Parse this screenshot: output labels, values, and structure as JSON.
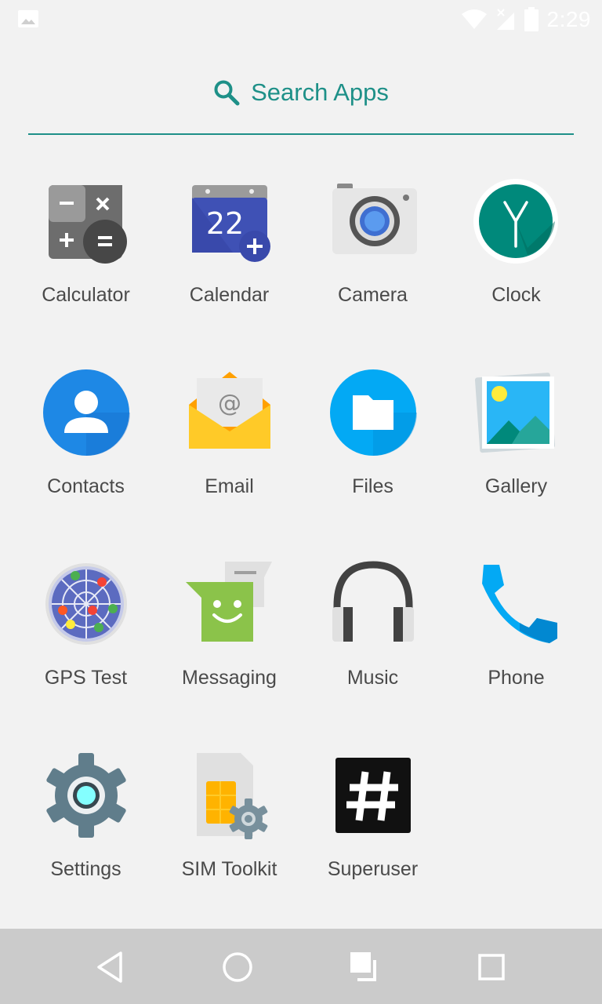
{
  "status_bar": {
    "time": "2:29"
  },
  "search": {
    "label": "Search Apps"
  },
  "apps": [
    {
      "label": "Calculator"
    },
    {
      "label": "Calendar"
    },
    {
      "label": "Camera"
    },
    {
      "label": "Clock"
    },
    {
      "label": "Contacts"
    },
    {
      "label": "Email"
    },
    {
      "label": "Files"
    },
    {
      "label": "Gallery"
    },
    {
      "label": "GPS Test"
    },
    {
      "label": "Messaging"
    },
    {
      "label": "Music"
    },
    {
      "label": "Phone"
    },
    {
      "label": "Settings"
    },
    {
      "label": "SIM Toolkit"
    },
    {
      "label": "Superuser"
    }
  ],
  "calendar_date": "22",
  "colors": {
    "accent": "#1e9088",
    "navbar": "#cbcbcb",
    "background": "#f2f2f2"
  },
  "icons": [
    "image-icon",
    "wifi-icon",
    "signal-icon",
    "battery-icon",
    "search-icon",
    "back-icon",
    "home-icon",
    "drag-icon",
    "recents-icon"
  ]
}
